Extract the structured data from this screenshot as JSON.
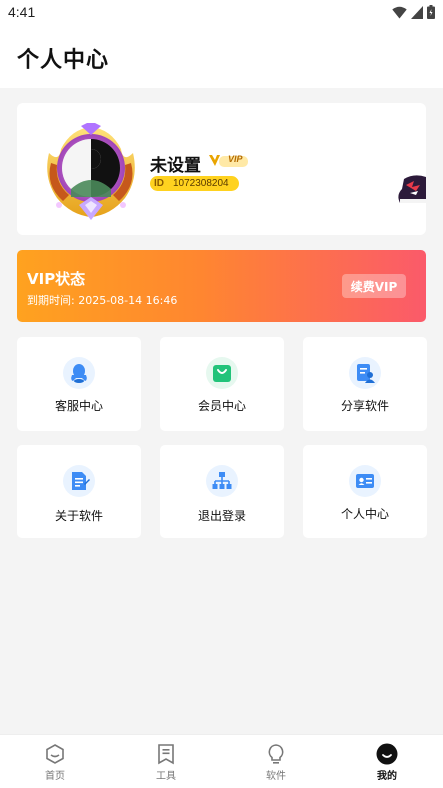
{
  "status_bar": {
    "time": "4:41",
    "icons": [
      "wifi-icon",
      "signal-icon",
      "battery-icon"
    ]
  },
  "header": {
    "title": "个人中心"
  },
  "profile": {
    "username": "未设置",
    "vip_badge": "VIP",
    "id_label": "ID",
    "id_number": "1072308204"
  },
  "vip_banner": {
    "title": "VIP状态",
    "expire_label": "到期时间:",
    "expire_value": "2025-08-14 16:46",
    "renew_label": "续费VIP"
  },
  "tiles": [
    {
      "label": "客服中心",
      "icon": "qq-icon"
    },
    {
      "label": "会员中心",
      "icon": "shopping-bag-icon"
    },
    {
      "label": "分享软件",
      "icon": "share-user-icon"
    },
    {
      "label": "关于软件",
      "icon": "document-icon"
    },
    {
      "label": "退出登录",
      "icon": "sitemap-icon"
    },
    {
      "label": "个人中心",
      "icon": "id-card-icon"
    }
  ],
  "tabbar": {
    "items": [
      {
        "label": "首页",
        "icon": "home-hexagon-icon",
        "active": false
      },
      {
        "label": "工具",
        "icon": "bookmark-icon",
        "active": false
      },
      {
        "label": "软件",
        "icon": "lightbulb-icon",
        "active": false
      },
      {
        "label": "我的",
        "icon": "profile-smile-icon",
        "active": true
      }
    ]
  },
  "colors": {
    "vip_gradient_start": "#ffa21f",
    "vip_gradient_end": "#fb5a6a",
    "id_badge": "#ffd21f",
    "icon_blue": "#3d8cf5",
    "icon_green": "#22c37a"
  }
}
